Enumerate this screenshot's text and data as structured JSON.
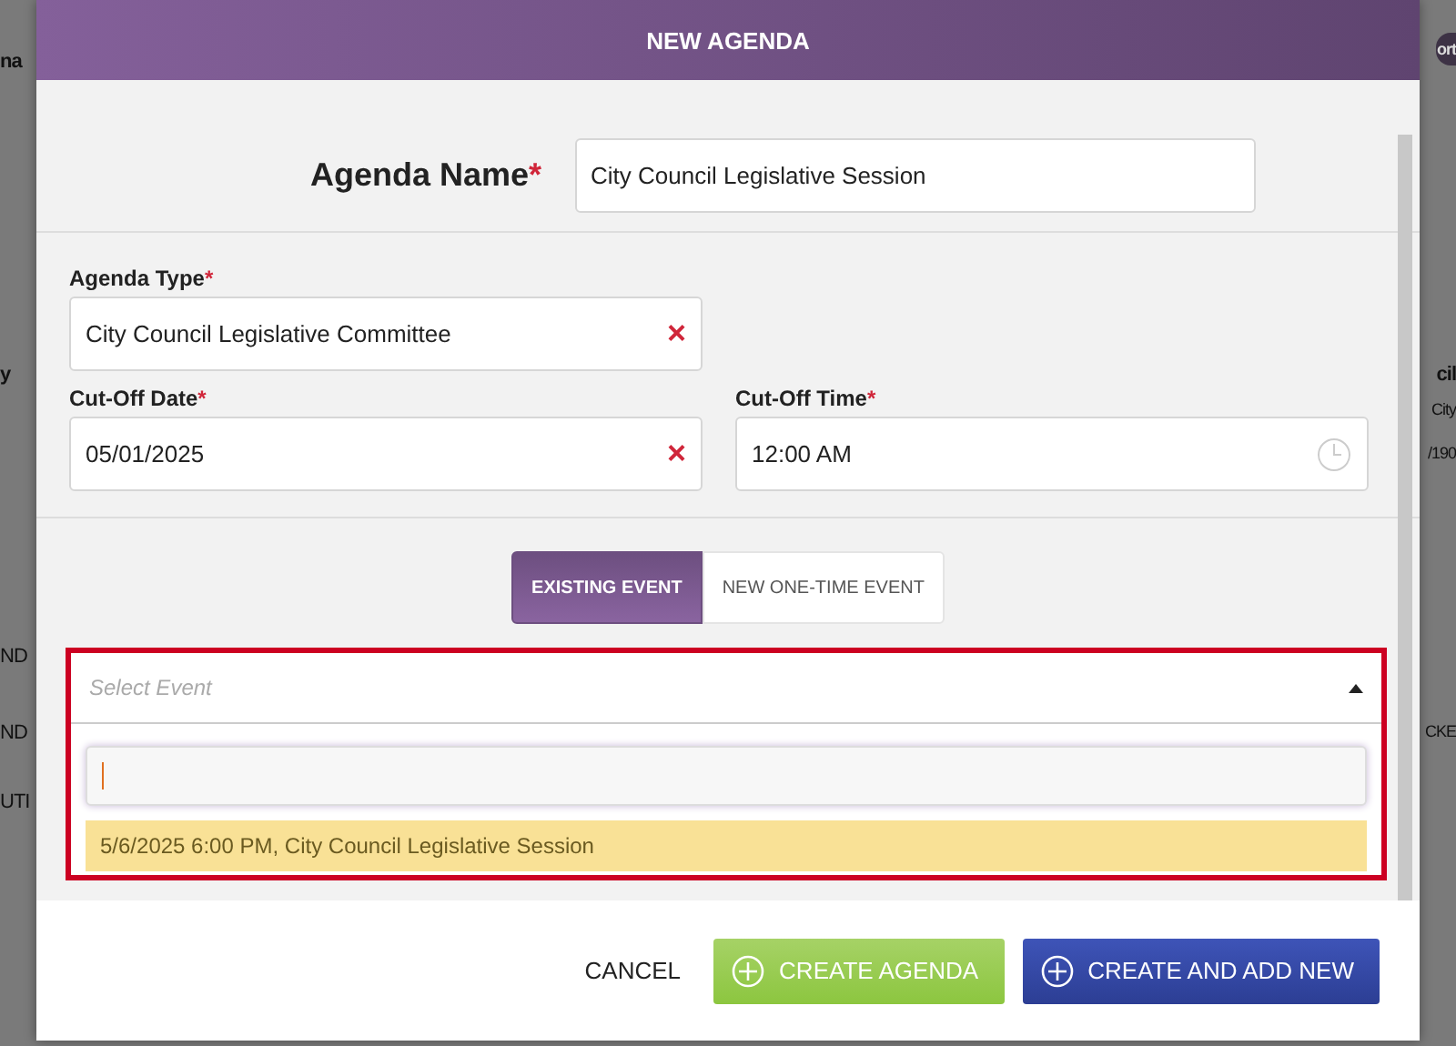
{
  "background": {
    "left": [
      "na",
      "y",
      "ND",
      "ND",
      "UTI"
    ],
    "right": [
      "ort",
      "cil",
      "City",
      "/190",
      "CKE"
    ]
  },
  "dialog": {
    "title": "NEW AGENDA",
    "agenda_name": {
      "label": "Agenda Name",
      "required_mark": "*",
      "value": "City Council Legislative Session"
    },
    "agenda_type": {
      "label": "Agenda Type",
      "required_mark": "*",
      "value": "City Council Legislative Committee",
      "clear": "×"
    },
    "cutoff_date": {
      "label": "Cut-Off Date",
      "required_mark": "*",
      "value": "05/01/2025",
      "clear": "×"
    },
    "cutoff_time": {
      "label": "Cut-Off Time",
      "required_mark": "*",
      "value": "12:00 AM"
    },
    "event_tabs": [
      {
        "label": "EXISTING EVENT",
        "selected": true
      },
      {
        "label": "NEW ONE-TIME EVENT",
        "selected": false
      }
    ],
    "event_select": {
      "placeholder": "Select Event",
      "expanded": true,
      "invalid": true,
      "options": [
        {
          "label": "5/6/2025 6:00 PM, City Council Legislative Session",
          "selected": true
        }
      ]
    },
    "buttons": [
      {
        "label": "CANCEL",
        "kind": "plain"
      },
      {
        "label": "CREATE AGENDA",
        "kind": "green"
      },
      {
        "label": "CREATE AND ADD NEW",
        "kind": "blue"
      }
    ]
  }
}
